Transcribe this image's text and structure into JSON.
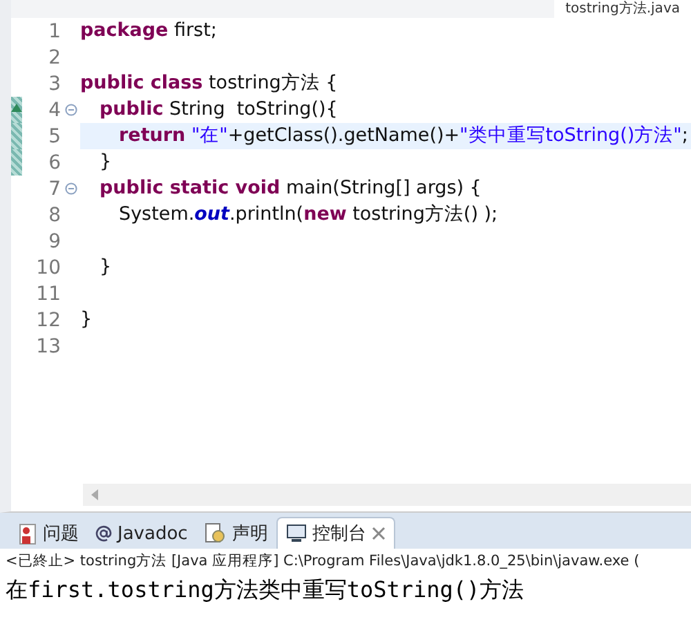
{
  "editor_tabs": [
    {
      "label": "tostring方法.java",
      "selected": true
    }
  ],
  "lines": [
    {
      "number": "1",
      "kind": "top",
      "fold": false,
      "override": false,
      "in_range": false,
      "current": false,
      "tokens": [
        {
          "kind": "keyword",
          "text": "package"
        },
        {
          "kind": "plain",
          "text": " first;"
        }
      ]
    },
    {
      "number": "2",
      "fold": false,
      "override": false,
      "in_range": false,
      "current": false
    },
    {
      "number": "3",
      "kind": "top",
      "fold": false,
      "override": false,
      "in_range": false,
      "current": false,
      "tokens": [
        {
          "kind": "keyword",
          "text": "public class"
        },
        {
          "kind": "plain",
          "text": " tostring方法 {"
        }
      ]
    },
    {
      "number": "4",
      "kind": "member",
      "fold": true,
      "override": true,
      "in_range": true,
      "current": false,
      "tokens": [
        {
          "kind": "keyword",
          "text": "public"
        },
        {
          "kind": "plain",
          "text": " String  toString(){"
        }
      ]
    },
    {
      "number": "5",
      "kind": "body",
      "fold": false,
      "override": false,
      "in_range": true,
      "current": true,
      "tokens": [
        {
          "kind": "keyword",
          "text": "return"
        },
        {
          "kind": "string",
          "text": " \"在\""
        },
        {
          "kind": "plain",
          "text": "+getClass().getName()+"
        },
        {
          "kind": "string",
          "text": "\"类中重写toString()方法\""
        },
        {
          "kind": "plain",
          "text": ";"
        }
      ]
    },
    {
      "number": "6",
      "kind": "member",
      "fold": false,
      "override": false,
      "in_range": true,
      "current": false,
      "tokens": [
        {
          "kind": "plain",
          "text": "}"
        }
      ]
    },
    {
      "number": "7",
      "kind": "member",
      "fold": true,
      "override": false,
      "in_range": false,
      "current": false,
      "tokens": [
        {
          "kind": "keyword",
          "text": "public static void"
        },
        {
          "kind": "plain",
          "text": " main(String[] args) {"
        }
      ]
    },
    {
      "number": "8",
      "kind": "body",
      "fold": false,
      "override": false,
      "in_range": false,
      "current": false,
      "tokens": [
        {
          "kind": "plain",
          "text": "System."
        },
        {
          "kind": "field",
          "text": "out"
        },
        {
          "kind": "plain",
          "text": ".println("
        },
        {
          "kind": "keyword",
          "text": "new"
        },
        {
          "kind": "plain",
          "text": " tostring方法() );"
        }
      ]
    },
    {
      "number": "9",
      "fold": false,
      "override": false,
      "in_range": false,
      "current": false
    },
    {
      "number": "10",
      "kind": "member",
      "fold": false,
      "override": false,
      "in_range": false,
      "current": false,
      "tokens": [
        {
          "kind": "plain",
          "text": "}"
        }
      ]
    },
    {
      "number": "11",
      "fold": false,
      "override": false,
      "in_range": false,
      "current": false
    },
    {
      "number": "12",
      "kind": "top",
      "fold": false,
      "override": false,
      "in_range": false,
      "current": false,
      "tokens": [
        {
          "kind": "plain",
          "text": "}"
        }
      ]
    },
    {
      "number": "13",
      "fold": false,
      "override": false,
      "in_range": false,
      "current": false
    }
  ],
  "panel_tabs": [
    {
      "kind": "problems",
      "label": "问题",
      "selected": false,
      "closable": false
    },
    {
      "kind": "javadoc",
      "label": "Javadoc",
      "selected": false,
      "closable": false
    },
    {
      "kind": "declaration",
      "label": "声明",
      "selected": false,
      "closable": false
    },
    {
      "kind": "console",
      "label": "控制台",
      "selected": true,
      "closable": true
    }
  ],
  "console": {
    "header": "<已終止> tostring方法 [Java 应用程序] C:\\Program Files\\Java\\jdk1.8.0_25\\bin\\javaw.exe (",
    "output": "在first.tostring方法类中重写toString()方法"
  }
}
